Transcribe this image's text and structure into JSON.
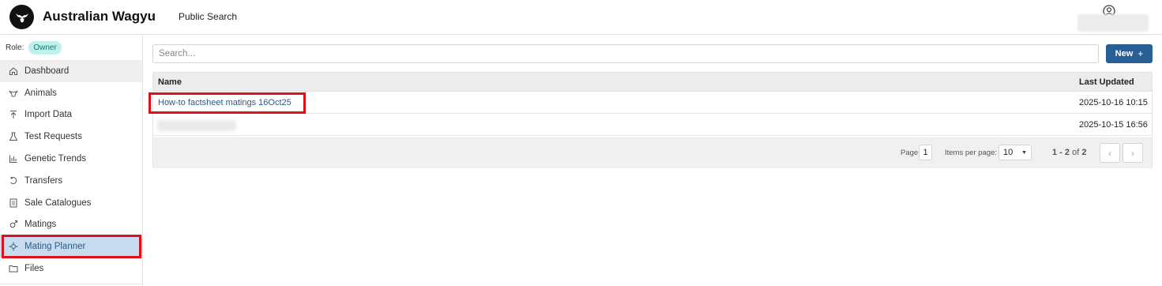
{
  "header": {
    "app_title": "Australian Wagyu",
    "public_search": "Public Search"
  },
  "sidebar": {
    "role_label": "Role:",
    "role_badge": "Owner",
    "items": [
      {
        "label": "Dashboard",
        "icon": "home-icon"
      },
      {
        "label": "Animals",
        "icon": "cow-icon"
      },
      {
        "label": "Import Data",
        "icon": "upload-icon"
      },
      {
        "label": "Test Requests",
        "icon": "flask-icon"
      },
      {
        "label": "Genetic Trends",
        "icon": "bar-chart-icon"
      },
      {
        "label": "Transfers",
        "icon": "transfer-icon"
      },
      {
        "label": "Sale Catalogues",
        "icon": "catalogue-icon"
      },
      {
        "label": "Matings",
        "icon": "gender-icon"
      },
      {
        "label": "Mating Planner",
        "icon": "planner-icon"
      },
      {
        "label": "Files",
        "icon": "folder-icon"
      }
    ]
  },
  "main": {
    "search_placeholder": "Search...",
    "new_button": "New",
    "table": {
      "columns": [
        "Name",
        "Last Updated"
      ],
      "rows": [
        {
          "name": "How-to factsheet matings 16Oct25",
          "updated": "2025-10-16 10:15"
        },
        {
          "name": "",
          "updated": "2025-10-15 16:56"
        }
      ]
    },
    "pagination": {
      "page_label": "Page",
      "page": "1",
      "items_label": "Items per page:",
      "items_per_page": "10",
      "range": "1 - 2",
      "of": "of",
      "total": "2"
    }
  },
  "colors": {
    "accent": "#2a5f96",
    "selected_bg": "#c8dcf0",
    "highlight": "#e0101a",
    "role_badge_bg": "#bff0ec"
  }
}
